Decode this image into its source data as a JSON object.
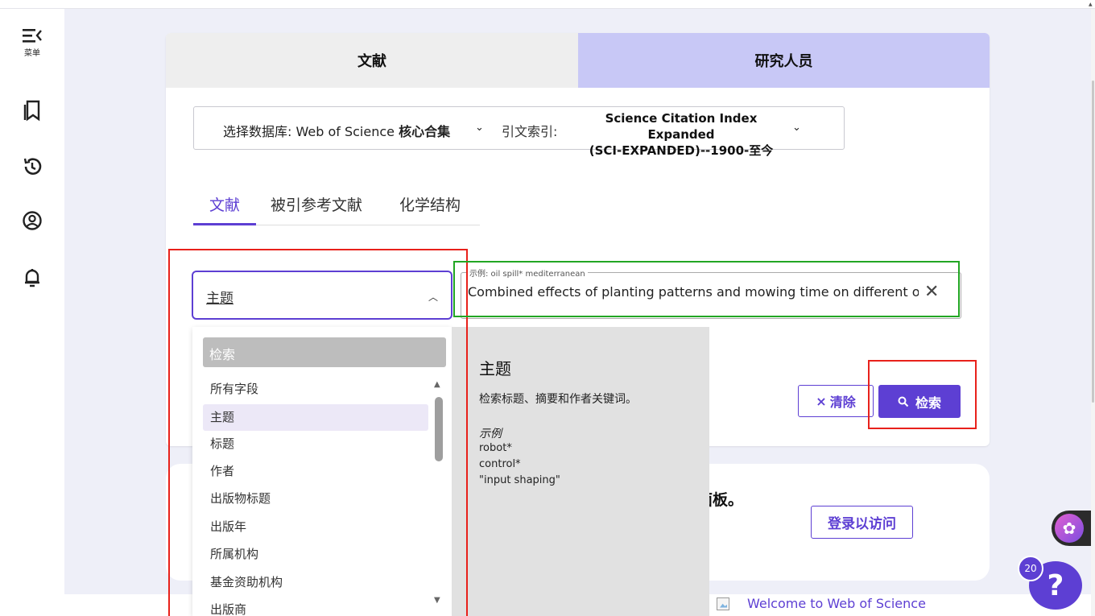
{
  "sidebar": {
    "menu_label": "菜单",
    "icons": [
      "menu-collapse-icon",
      "bookmark-icon",
      "history-icon",
      "account-icon",
      "bell-icon"
    ]
  },
  "top_tabs": {
    "documents": "文献",
    "researchers": "研究人员"
  },
  "database": {
    "label_prefix": "选择数据库: Web of Science ",
    "label_bold": "核心合集",
    "index_label": "引文索引:",
    "index_value_line1": "Science Citation Index Expanded",
    "index_value_line2": "(SCI-EXPANDED)--1900-至今"
  },
  "search_tabs": [
    "文献",
    "被引参考文献",
    "化学结构"
  ],
  "field_select": {
    "value": "主题"
  },
  "query": {
    "legend": "示例: oil spill* mediterranean",
    "value": "Combined effects of planting patterns and mowing time on different organ"
  },
  "buttons": {
    "clear": "清除",
    "search": "检索",
    "login": "登录以访问"
  },
  "dropdown": {
    "search_placeholder": "检索",
    "items": [
      "所有字段",
      "主题",
      "标题",
      "作者",
      "出版物标题",
      "出版年",
      "所属机构",
      "基金资助机构",
      "出版商"
    ],
    "selected": "主题"
  },
  "description": {
    "title": "主题",
    "text": "检索标题、摘要和作者关键词。",
    "example_label": "示例",
    "examples": [
      "robot*",
      "control*",
      "\"input shaping\""
    ]
  },
  "card2": {
    "text": "面板。"
  },
  "help": {
    "badge": "20",
    "symbol": "?"
  },
  "footer": {
    "welcome": "Welcome to Web of Science"
  },
  "colors": {
    "accent": "#5d3fd3",
    "highlight_red": "#e8211b",
    "highlight_green": "#22a623",
    "researcher_tab": "#c8c8f6",
    "page_bg": "#eeeff8"
  }
}
